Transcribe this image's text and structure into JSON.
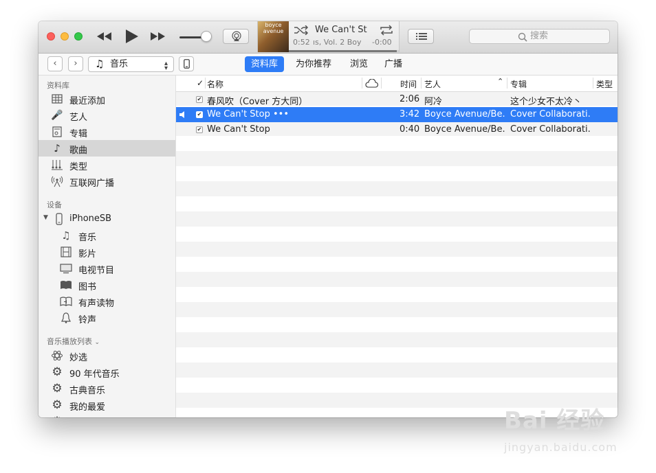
{
  "player": {
    "lcd_title": "We Can't St",
    "elapsed": "0:52",
    "subtitle": "ıs, Vol. 2 Boy",
    "remaining": "-0:00",
    "artwork_text": "boyce avenue",
    "progress": 0.98,
    "volume": 0.9,
    "search_placeholder": "搜索"
  },
  "nav": {
    "media_label": "音乐",
    "tabs": [
      {
        "label": "资料库",
        "active": true
      },
      {
        "label": "为你推荐",
        "active": false
      },
      {
        "label": "浏览",
        "active": false
      },
      {
        "label": "广播",
        "active": false
      }
    ]
  },
  "sidebar": {
    "library_header": "资料库",
    "library": [
      {
        "label": "最近添加",
        "icon": "grid-icon"
      },
      {
        "label": "艺人",
        "icon": "microphone-icon"
      },
      {
        "label": "专辑",
        "icon": "album-icon"
      },
      {
        "label": "歌曲",
        "icon": "music-note-icon",
        "selected": true
      },
      {
        "label": "类型",
        "icon": "genre-icon"
      },
      {
        "label": "互联网广播",
        "icon": "radio-antenna-icon"
      }
    ],
    "devices_header": "设备",
    "device_name": "iPhoneSB",
    "device_items": [
      {
        "label": "音乐",
        "icon": "music-note-icon"
      },
      {
        "label": "影片",
        "icon": "film-icon"
      },
      {
        "label": "电视节目",
        "icon": "tv-icon"
      },
      {
        "label": "图书",
        "icon": "book-icon"
      },
      {
        "label": "有声读物",
        "icon": "audiobook-icon"
      },
      {
        "label": "铃声",
        "icon": "bell-icon"
      }
    ],
    "playlists_header": "音乐播放列表",
    "playlists": [
      {
        "label": "妙选",
        "icon": "atom-icon"
      },
      {
        "label": "90 年代音乐",
        "icon": "gear-icon"
      },
      {
        "label": "古典音乐",
        "icon": "gear-icon"
      },
      {
        "label": "我的最爱",
        "icon": "gear-icon"
      }
    ]
  },
  "table": {
    "columns": {
      "check": "✓",
      "name": "名称",
      "time": "时间",
      "artist": "艺人",
      "album": "专辑",
      "genre": "类型"
    },
    "rows": [
      {
        "name": "春风吹（Cover 方大同）",
        "time": "2:06",
        "artist": "阿冷",
        "album": "这个少女不太冷丶",
        "playing": false,
        "selected": false
      },
      {
        "name": "We Can't Stop  •••",
        "time": "3:42",
        "artist": "Boyce Avenue/Be...",
        "album": "Cover Collaborati...",
        "playing": true,
        "selected": true
      },
      {
        "name": "We Can't Stop",
        "time": "0:40",
        "artist": "Boyce Avenue/Be...",
        "album": "Cover Collaborati...",
        "playing": false,
        "selected": false
      }
    ]
  },
  "watermark": {
    "logo": "Bai 经验",
    "url": "jingyan.baidu.com"
  }
}
